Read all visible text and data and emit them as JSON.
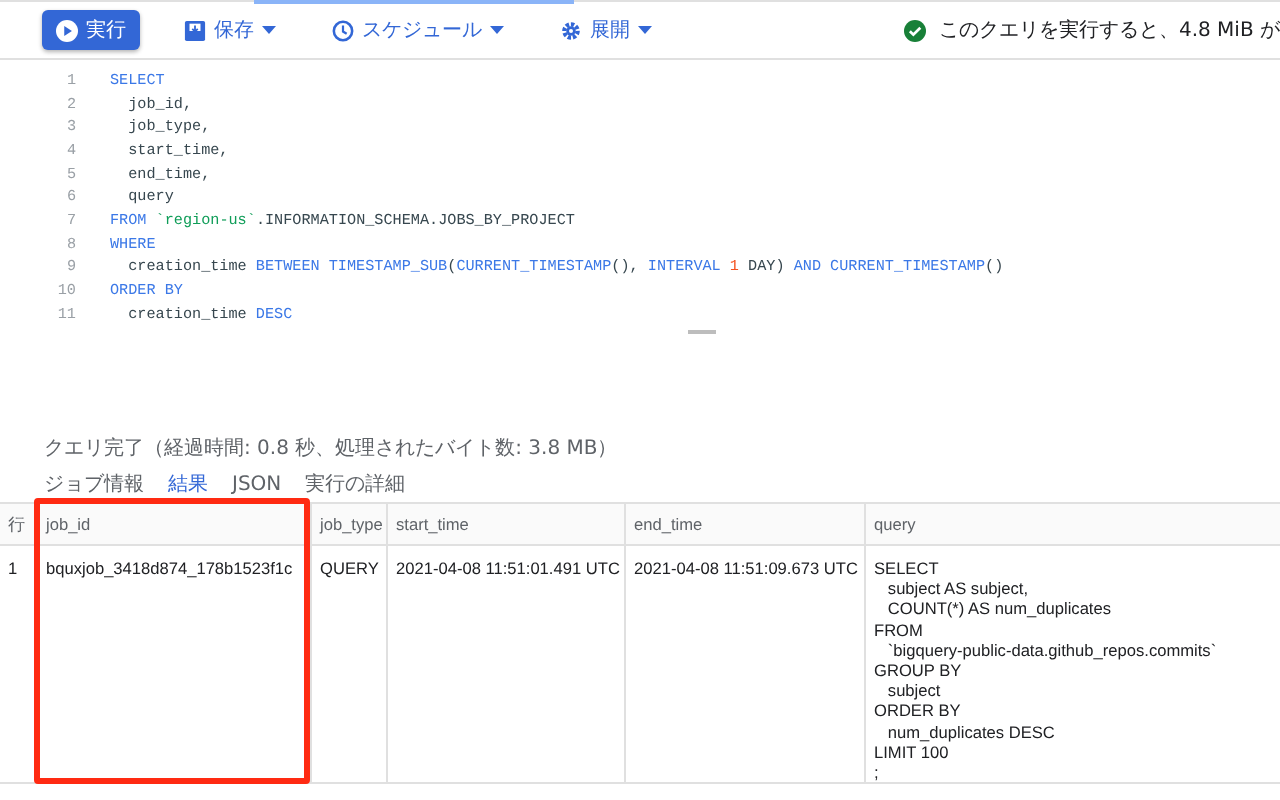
{
  "toolbar": {
    "buttons": [
      {
        "label": "実行",
        "kind": "run"
      },
      {
        "label": "保存",
        "kind": "save"
      },
      {
        "label": "スケジュール",
        "kind": "schedule"
      },
      {
        "label": "展開",
        "kind": "deploy"
      }
    ],
    "validation": "このクエリを実行すると、4.8 MiB が"
  },
  "editor": {
    "lines": [
      {
        "number": "1",
        "tokens": [
          {
            "kind": "kw",
            "text": "SELECT"
          }
        ]
      },
      {
        "number": "2",
        "tokens": [
          {
            "kind": "plain",
            "text": "  job_id,"
          }
        ]
      },
      {
        "number": "3",
        "tokens": [
          {
            "kind": "plain",
            "text": "  job_type,"
          }
        ]
      },
      {
        "number": "4",
        "tokens": [
          {
            "kind": "plain",
            "text": "  start_time,"
          }
        ]
      },
      {
        "number": "5",
        "tokens": [
          {
            "kind": "plain",
            "text": "  end_time,"
          }
        ]
      },
      {
        "number": "6",
        "tokens": [
          {
            "kind": "plain",
            "text": "  query"
          }
        ]
      },
      {
        "number": "7",
        "tokens": [
          {
            "kind": "kw",
            "text": "FROM "
          },
          {
            "kind": "str",
            "text": "`region-us`"
          },
          {
            "kind": "plain",
            "text": ".INFORMATION_SCHEMA.JOBS_BY_PROJECT"
          }
        ]
      },
      {
        "number": "8",
        "tokens": [
          {
            "kind": "kw",
            "text": "WHERE"
          }
        ]
      },
      {
        "number": "9",
        "tokens": [
          {
            "kind": "plain",
            "text": "  creation_time "
          },
          {
            "kind": "kw",
            "text": "BETWEEN TIMESTAMP_SUB"
          },
          {
            "kind": "plain",
            "text": "("
          },
          {
            "kind": "kw",
            "text": "CURRENT_TIMESTAMP"
          },
          {
            "kind": "plain",
            "text": "(), "
          },
          {
            "kind": "kw",
            "text": "INTERVAL "
          },
          {
            "kind": "num",
            "text": "1"
          },
          {
            "kind": "plain",
            "text": " DAY) "
          },
          {
            "kind": "kw",
            "text": "AND CURRENT_TIMESTAMP"
          },
          {
            "kind": "plain",
            "text": "()"
          }
        ]
      },
      {
        "number": "10",
        "tokens": [
          {
            "kind": "kw",
            "text": "ORDER BY"
          }
        ]
      },
      {
        "number": "11",
        "tokens": [
          {
            "kind": "plain",
            "text": "  creation_time "
          },
          {
            "kind": "kw",
            "text": "DESC"
          }
        ]
      }
    ]
  },
  "results": {
    "status": "クエリ完了（経過時間: 0.8 秒、処理されたバイト数: 3.8 MB）",
    "tabs": [
      {
        "label": "ジョブ情報",
        "selected": false
      },
      {
        "label": "結果",
        "selected": true
      },
      {
        "label": "JSON",
        "selected": false
      },
      {
        "label": "実行の詳細",
        "selected": false
      }
    ],
    "table": {
      "columns": [
        "行",
        "job_id",
        "job_type",
        "start_time",
        "end_time",
        "query"
      ],
      "rows": [
        {
          "cells": [
            "1",
            "bquxjob_3418d874_178b1523f1c",
            "QUERY",
            "2021-04-08 11:51:01.491 UTC",
            "2021-04-08 11:51:09.673 UTC"
          ],
          "query_lines": [
            "SELECT",
            "   subject AS subject,",
            "   COUNT(*) AS num_duplicates",
            "FROM",
            "   `bigquery-public-data.github_repos.commits`",
            "GROUP BY",
            "   subject",
            "ORDER BY",
            "   num_duplicates DESC",
            "LIMIT 100",
            ";"
          ]
        }
      ]
    }
  }
}
